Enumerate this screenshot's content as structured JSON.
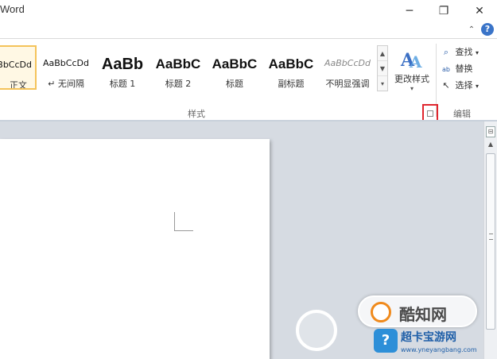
{
  "window": {
    "title": "Word",
    "minimize_glyph": "─",
    "restore_glyph": "❐",
    "close_glyph": "✕",
    "ribbon_minimize_glyph": "⌃",
    "help_glyph": "?"
  },
  "styles_gallery": {
    "items": [
      {
        "preview": "AaBbCcDd",
        "name": "正文",
        "selected": true
      },
      {
        "preview": "AaBbCcDd",
        "name": "↵ 无间隔",
        "selected": false
      },
      {
        "preview": "AaBb",
        "name": "标题 1",
        "selected": false
      },
      {
        "preview": "AaBbC",
        "name": "标题 2",
        "selected": false
      },
      {
        "preview": "AaBbC",
        "name": "标题",
        "selected": false
      },
      {
        "preview": "AaBbC",
        "name": "副标题",
        "selected": false
      },
      {
        "preview": "AaBbCcDd",
        "name": "不明显强调",
        "selected": false
      }
    ],
    "scroll_up": "▲",
    "scroll_down": "▼",
    "more": "▾"
  },
  "change_styles": {
    "label": "更改样式",
    "arrow": "▾"
  },
  "edit_group": {
    "find": "查找",
    "replace": "替换",
    "select": "选择",
    "label": "编辑"
  },
  "styles_group_label": "样式",
  "watermarks": {
    "zhiwang": "酷知网",
    "site_title": "超卡宝游网",
    "site_url": "www.yneyangbang.com"
  },
  "colors": {
    "selected_border": "#f4c35a",
    "highlight_red": "#e0262e",
    "doc_background": "#d6dbe2"
  }
}
